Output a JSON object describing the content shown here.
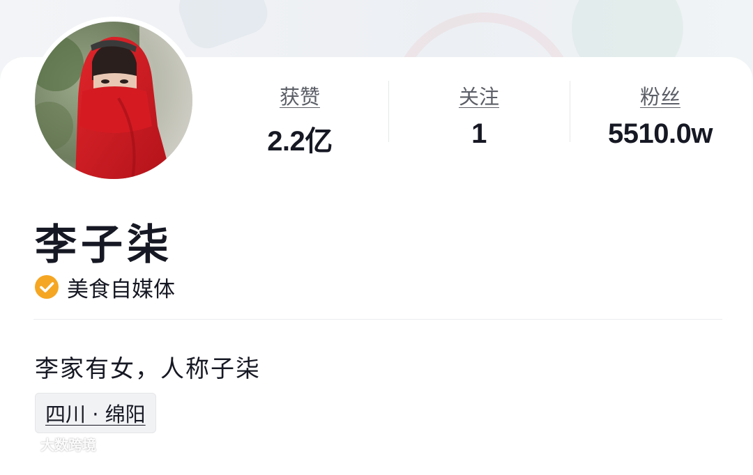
{
  "profile": {
    "name": "李子柒",
    "verified_label": "美食自媒体",
    "bio": "李家有女，人称子柒",
    "location": "四川 · 绵阳",
    "avatar_icon": "user-avatar"
  },
  "stats": [
    {
      "label": "获赞",
      "value": "2.2亿"
    },
    {
      "label": "关注",
      "value": "1"
    },
    {
      "label": "粉丝",
      "value": "5510.0w"
    }
  ],
  "watermark": {
    "text": "大数跨境"
  },
  "colors": {
    "verified_badge": "#f5a623",
    "text_primary": "#161823",
    "text_secondary": "#5b5e66"
  }
}
